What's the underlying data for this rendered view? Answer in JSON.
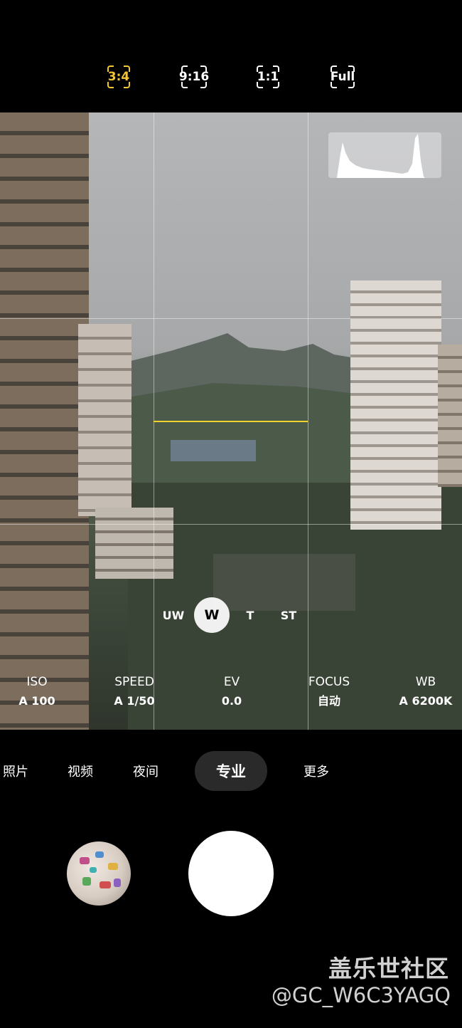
{
  "aspect_ratios": {
    "items": [
      {
        "label": "3:4",
        "active": true
      },
      {
        "label": "9:16",
        "active": false
      },
      {
        "label": "1:1",
        "active": false
      },
      {
        "label": "Full",
        "active": false
      }
    ]
  },
  "lens_selector": {
    "items": [
      {
        "label": "UW",
        "active": false
      },
      {
        "label": "W",
        "active": true
      },
      {
        "label": "T",
        "active": false
      },
      {
        "label": "ST",
        "active": false
      }
    ]
  },
  "pro_settings": [
    {
      "label": "ISO",
      "value": "A 100"
    },
    {
      "label": "SPEED",
      "value": "A 1/50"
    },
    {
      "label": "EV",
      "value": "0.0"
    },
    {
      "label": "FOCUS",
      "value": "自动"
    },
    {
      "label": "WB",
      "value": "A 6200K"
    }
  ],
  "modes": [
    {
      "label": "照片",
      "active": false
    },
    {
      "label": "视频",
      "active": false
    },
    {
      "label": "夜间",
      "active": false
    },
    {
      "label": "专业",
      "active": true
    },
    {
      "label": "更多",
      "active": false
    }
  ],
  "watermark": {
    "title": "盖乐世社区",
    "user": "@GC_W6C3YAGQ"
  },
  "colors": {
    "accent": "#f2c531",
    "level_line": "#f2d22a",
    "background": "#000000"
  }
}
